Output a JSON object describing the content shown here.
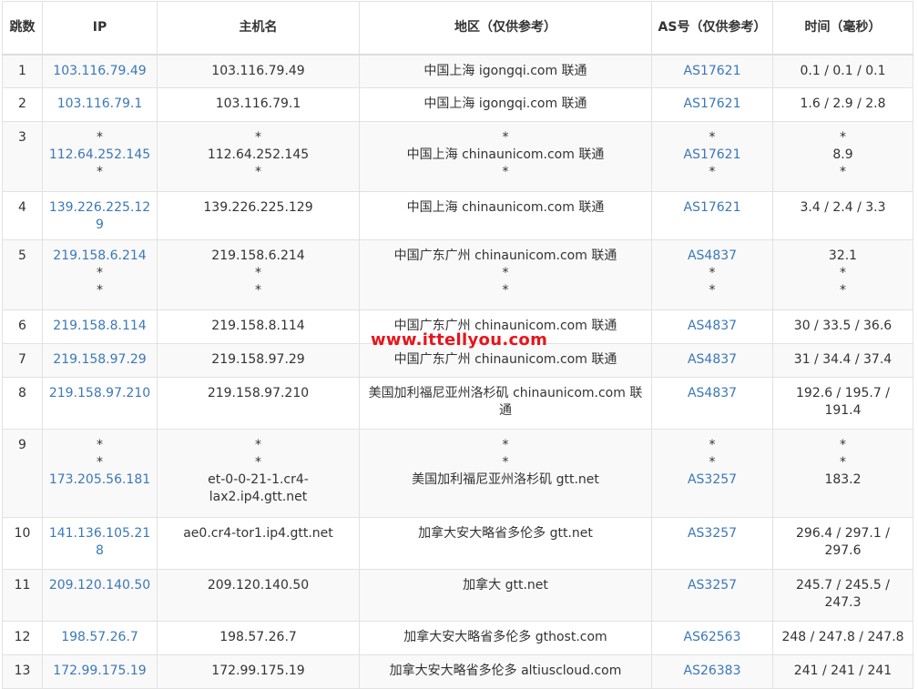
{
  "headers": {
    "hop": "跳数",
    "ip": "IP",
    "host": "主机名",
    "region": "地区（仅供参考）",
    "as": "AS号（仅供参考）",
    "time": "时间（毫秒）"
  },
  "rows": [
    {
      "hop": "1",
      "ip": [
        "103.116.79.49"
      ],
      "host": [
        "103.116.79.49"
      ],
      "region": [
        "中国上海 igongqi.com 联通"
      ],
      "as": [
        "AS17621"
      ],
      "time": [
        "0.1 / 0.1 / 0.1"
      ]
    },
    {
      "hop": "2",
      "ip": [
        "103.116.79.1"
      ],
      "host": [
        "103.116.79.1"
      ],
      "region": [
        "中国上海 igongqi.com 联通"
      ],
      "as": [
        "AS17621"
      ],
      "time": [
        "1.6 / 2.9 / 2.8"
      ]
    },
    {
      "hop": "3",
      "ip": [
        "*",
        "112.64.252.145",
        "*"
      ],
      "host": [
        "*",
        "112.64.252.145",
        "*"
      ],
      "region": [
        "*",
        "中国上海 chinaunicom.com 联通",
        "*"
      ],
      "as": [
        "*",
        "AS17621",
        "*"
      ],
      "time": [
        "*",
        "8.9",
        "*"
      ]
    },
    {
      "hop": "4",
      "ip": [
        "139.226.225.129"
      ],
      "host": [
        "139.226.225.129"
      ],
      "region": [
        "中国上海 chinaunicom.com 联通"
      ],
      "as": [
        "AS17621"
      ],
      "time": [
        "3.4 / 2.4 / 3.3"
      ]
    },
    {
      "hop": "5",
      "ip": [
        "219.158.6.214",
        "*",
        "*"
      ],
      "host": [
        "219.158.6.214",
        "*",
        "*"
      ],
      "region": [
        "中国广东广州 chinaunicom.com 联通",
        "*",
        "*"
      ],
      "as": [
        "AS4837",
        "*",
        "*"
      ],
      "time": [
        "32.1",
        "*",
        "*"
      ]
    },
    {
      "hop": "6",
      "ip": [
        "219.158.8.114"
      ],
      "host": [
        "219.158.8.114"
      ],
      "region": [
        "中国广东广州 chinaunicom.com 联通"
      ],
      "as": [
        "AS4837"
      ],
      "time": [
        "30 / 33.5 / 36.6"
      ]
    },
    {
      "hop": "7",
      "ip": [
        "219.158.97.29"
      ],
      "host": [
        "219.158.97.29"
      ],
      "region": [
        "中国广东广州 chinaunicom.com 联通"
      ],
      "as": [
        "AS4837"
      ],
      "time": [
        "31 / 34.4 / 37.4"
      ]
    },
    {
      "hop": "8",
      "ip": [
        "219.158.97.210"
      ],
      "host": [
        "219.158.97.210"
      ],
      "region": [
        "美国加利福尼亚州洛杉矶 chinaunicom.com 联通"
      ],
      "as": [
        "AS4837"
      ],
      "time": [
        "192.6 / 195.7 / 191.4"
      ]
    },
    {
      "hop": "9",
      "ip": [
        "*",
        "*",
        "173.205.56.181"
      ],
      "host": [
        "*",
        "*",
        "et-0-0-21-1.cr4-lax2.ip4.gtt.net"
      ],
      "region": [
        "*",
        "*",
        "美国加利福尼亚州洛杉矶 gtt.net"
      ],
      "as": [
        "*",
        "*",
        "AS3257"
      ],
      "time": [
        "*",
        "*",
        "183.2"
      ]
    },
    {
      "hop": "10",
      "ip": [
        "141.136.105.218"
      ],
      "host": [
        "ae0.cr4-tor1.ip4.gtt.net"
      ],
      "region": [
        "加拿大安大略省多伦多 gtt.net"
      ],
      "as": [
        "AS3257"
      ],
      "time": [
        "296.4 / 297.1 / 297.6"
      ]
    },
    {
      "hop": "11",
      "ip": [
        "209.120.140.50"
      ],
      "host": [
        "209.120.140.50"
      ],
      "region": [
        "加拿大 gtt.net"
      ],
      "as": [
        "AS3257"
      ],
      "time": [
        "245.7 / 245.5 / 247.3"
      ]
    },
    {
      "hop": "12",
      "ip": [
        "198.57.26.7"
      ],
      "host": [
        "198.57.26.7"
      ],
      "region": [
        "加拿大安大略省多伦多 gthost.com"
      ],
      "as": [
        "AS62563"
      ],
      "time": [
        "248 / 247.8 / 247.8"
      ]
    },
    {
      "hop": "13",
      "ip": [
        "172.99.175.19"
      ],
      "host": [
        "172.99.175.19"
      ],
      "region": [
        "加拿大安大略省多伦多 altiuscloud.com"
      ],
      "as": [
        "AS26383"
      ],
      "time": [
        "241 / 241 / 241"
      ]
    }
  ],
  "watermark": "www.ittellyou.com",
  "colors": {
    "link": "#3b78b8",
    "watermark": "#e8141b",
    "stripe": "#f9f9f9",
    "border": "#e2e2e2"
  }
}
